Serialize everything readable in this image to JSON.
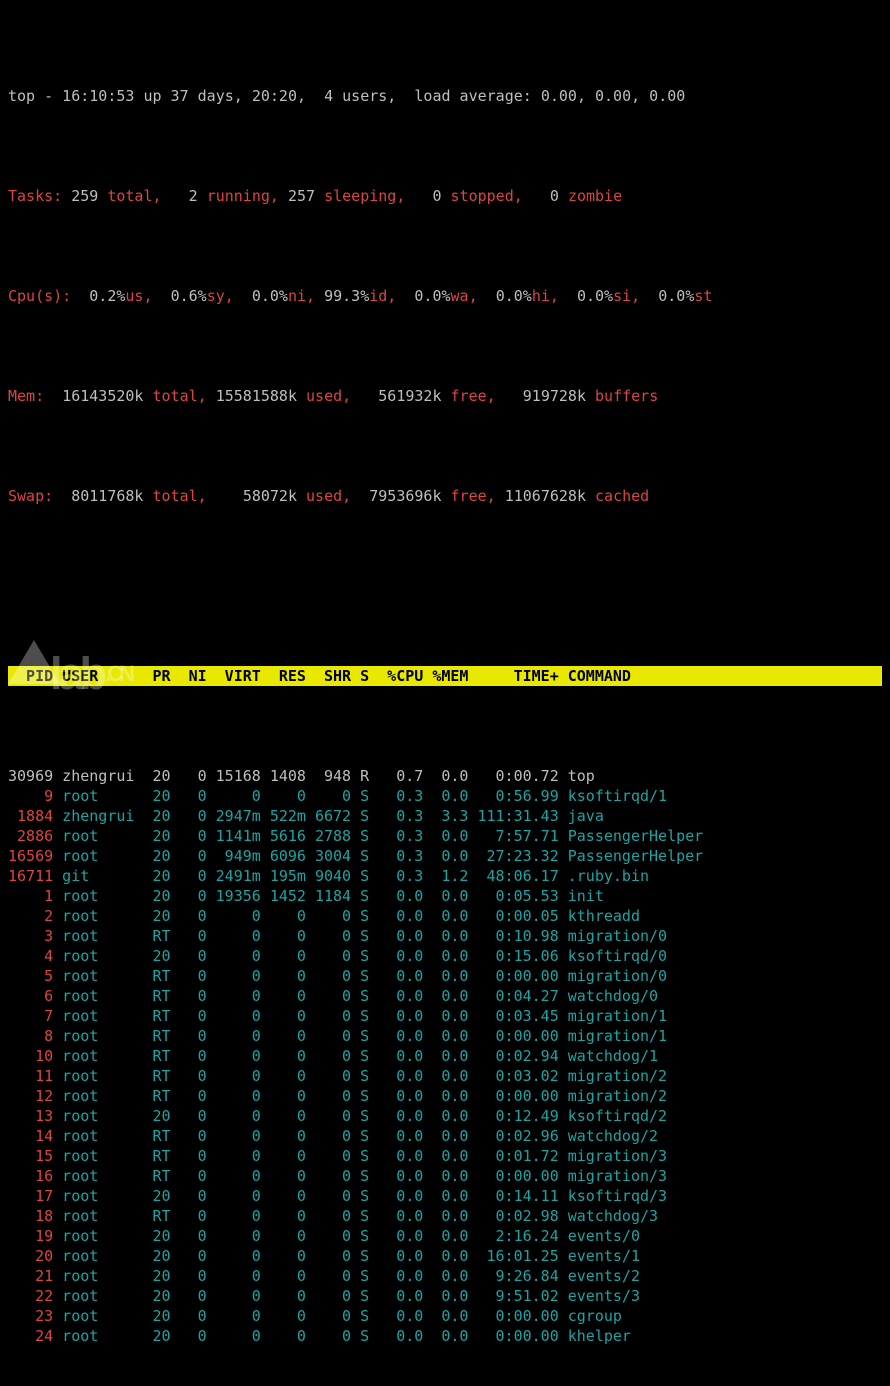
{
  "summary": {
    "line1_a": "top - 16:10:53 up 37 days, 20:20,  4 users,  load average: 0.00, 0.00, 0.00",
    "tasks": {
      "label": "Tasks:",
      "total": "259",
      "total_lbl": "total,",
      "running": "2",
      "running_lbl": "running,",
      "sleeping": "257",
      "sleeping_lbl": "sleeping,",
      "stopped": "0",
      "stopped_lbl": "stopped,",
      "zombie": "0",
      "zombie_lbl": "zombie"
    },
    "cpu": {
      "label": "Cpu(s):",
      "us": "0.2%",
      "us_lbl": "us,",
      "sy": "0.6%",
      "sy_lbl": "sy,",
      "ni": "0.0%",
      "ni_lbl": "ni,",
      "id": "99.3%",
      "id_lbl": "id,",
      "wa": "0.0%",
      "wa_lbl": "wa,",
      "hi": "0.0%",
      "hi_lbl": "hi,",
      "si": "0.0%",
      "si_lbl": "si,",
      "st": "0.0%",
      "st_lbl": "st"
    },
    "mem": {
      "label": "Mem:",
      "total": "16143520k",
      "total_lbl": "total,",
      "used": "15581588k",
      "used_lbl": "used,",
      "free": "561932k",
      "free_lbl": "free,",
      "buffers": "919728k",
      "buffers_lbl": "buffers"
    },
    "swap": {
      "label": "Swap:",
      "total": "8011768k",
      "total_lbl": "total,",
      "used": "58072k",
      "used_lbl": "used,",
      "free": "7953696k",
      "free_lbl": "free,",
      "cached": "11067628k",
      "cached_lbl": "cached"
    }
  },
  "columns": {
    "pid": "PID",
    "user": "USER",
    "pr": "PR",
    "ni": "NI",
    "virt": "VIRT",
    "res": "RES",
    "shr": "SHR",
    "s": "S",
    "cpu": "%CPU",
    "mem": "%MEM",
    "time": "TIME+",
    "cmd": "COMMAND"
  },
  "rows": [
    {
      "pid": "30969",
      "user": "zhengrui",
      "pr": "20",
      "ni": "0",
      "virt": "15168",
      "res": "1408",
      "shr": "948",
      "s": "R",
      "cpu": "0.7",
      "mem": "0.0",
      "time": "0:00.72",
      "cmd": "top",
      "hl": false
    },
    {
      "pid": "9",
      "user": "root",
      "pr": "20",
      "ni": "0",
      "virt": "0",
      "res": "0",
      "shr": "0",
      "s": "S",
      "cpu": "0.3",
      "mem": "0.0",
      "time": "0:56.99",
      "cmd": "ksoftirqd/1",
      "hl": true
    },
    {
      "pid": "1884",
      "user": "zhengrui",
      "pr": "20",
      "ni": "0",
      "virt": "2947m",
      "res": "522m",
      "shr": "6672",
      "s": "S",
      "cpu": "0.3",
      "mem": "3.3",
      "time": "111:31.43",
      "cmd": "java",
      "hl": true
    },
    {
      "pid": "2886",
      "user": "root",
      "pr": "20",
      "ni": "0",
      "virt": "1141m",
      "res": "5616",
      "shr": "2788",
      "s": "S",
      "cpu": "0.3",
      "mem": "0.0",
      "time": "7:57.71",
      "cmd": "PassengerHelper",
      "hl": true
    },
    {
      "pid": "16569",
      "user": "root",
      "pr": "20",
      "ni": "0",
      "virt": "949m",
      "res": "6096",
      "shr": "3004",
      "s": "S",
      "cpu": "0.3",
      "mem": "0.0",
      "time": "27:23.32",
      "cmd": "PassengerHelper",
      "hl": true
    },
    {
      "pid": "16711",
      "user": "git",
      "pr": "20",
      "ni": "0",
      "virt": "2491m",
      "res": "195m",
      "shr": "9040",
      "s": "S",
      "cpu": "0.3",
      "mem": "1.2",
      "time": "48:06.17",
      "cmd": ".ruby.bin",
      "hl": true
    },
    {
      "pid": "1",
      "user": "root",
      "pr": "20",
      "ni": "0",
      "virt": "19356",
      "res": "1452",
      "shr": "1184",
      "s": "S",
      "cpu": "0.0",
      "mem": "0.0",
      "time": "0:05.53",
      "cmd": "init",
      "hl": true
    },
    {
      "pid": "2",
      "user": "root",
      "pr": "20",
      "ni": "0",
      "virt": "0",
      "res": "0",
      "shr": "0",
      "s": "S",
      "cpu": "0.0",
      "mem": "0.0",
      "time": "0:00.05",
      "cmd": "kthreadd",
      "hl": true
    },
    {
      "pid": "3",
      "user": "root",
      "pr": "RT",
      "ni": "0",
      "virt": "0",
      "res": "0",
      "shr": "0",
      "s": "S",
      "cpu": "0.0",
      "mem": "0.0",
      "time": "0:10.98",
      "cmd": "migration/0",
      "hl": true
    },
    {
      "pid": "4",
      "user": "root",
      "pr": "20",
      "ni": "0",
      "virt": "0",
      "res": "0",
      "shr": "0",
      "s": "S",
      "cpu": "0.0",
      "mem": "0.0",
      "time": "0:15.06",
      "cmd": "ksoftirqd/0",
      "hl": true
    },
    {
      "pid": "5",
      "user": "root",
      "pr": "RT",
      "ni": "0",
      "virt": "0",
      "res": "0",
      "shr": "0",
      "s": "S",
      "cpu": "0.0",
      "mem": "0.0",
      "time": "0:00.00",
      "cmd": "migration/0",
      "hl": true
    },
    {
      "pid": "6",
      "user": "root",
      "pr": "RT",
      "ni": "0",
      "virt": "0",
      "res": "0",
      "shr": "0",
      "s": "S",
      "cpu": "0.0",
      "mem": "0.0",
      "time": "0:04.27",
      "cmd": "watchdog/0",
      "hl": true
    },
    {
      "pid": "7",
      "user": "root",
      "pr": "RT",
      "ni": "0",
      "virt": "0",
      "res": "0",
      "shr": "0",
      "s": "S",
      "cpu": "0.0",
      "mem": "0.0",
      "time": "0:03.45",
      "cmd": "migration/1",
      "hl": true
    },
    {
      "pid": "8",
      "user": "root",
      "pr": "RT",
      "ni": "0",
      "virt": "0",
      "res": "0",
      "shr": "0",
      "s": "S",
      "cpu": "0.0",
      "mem": "0.0",
      "time": "0:00.00",
      "cmd": "migration/1",
      "hl": true
    },
    {
      "pid": "10",
      "user": "root",
      "pr": "RT",
      "ni": "0",
      "virt": "0",
      "res": "0",
      "shr": "0",
      "s": "S",
      "cpu": "0.0",
      "mem": "0.0",
      "time": "0:02.94",
      "cmd": "watchdog/1",
      "hl": true
    },
    {
      "pid": "11",
      "user": "root",
      "pr": "RT",
      "ni": "0",
      "virt": "0",
      "res": "0",
      "shr": "0",
      "s": "S",
      "cpu": "0.0",
      "mem": "0.0",
      "time": "0:03.02",
      "cmd": "migration/2",
      "hl": true
    },
    {
      "pid": "12",
      "user": "root",
      "pr": "RT",
      "ni": "0",
      "virt": "0",
      "res": "0",
      "shr": "0",
      "s": "S",
      "cpu": "0.0",
      "mem": "0.0",
      "time": "0:00.00",
      "cmd": "migration/2",
      "hl": true
    },
    {
      "pid": "13",
      "user": "root",
      "pr": "20",
      "ni": "0",
      "virt": "0",
      "res": "0",
      "shr": "0",
      "s": "S",
      "cpu": "0.0",
      "mem": "0.0",
      "time": "0:12.49",
      "cmd": "ksoftirqd/2",
      "hl": true
    },
    {
      "pid": "14",
      "user": "root",
      "pr": "RT",
      "ni": "0",
      "virt": "0",
      "res": "0",
      "shr": "0",
      "s": "S",
      "cpu": "0.0",
      "mem": "0.0",
      "time": "0:02.96",
      "cmd": "watchdog/2",
      "hl": true
    },
    {
      "pid": "15",
      "user": "root",
      "pr": "RT",
      "ni": "0",
      "virt": "0",
      "res": "0",
      "shr": "0",
      "s": "S",
      "cpu": "0.0",
      "mem": "0.0",
      "time": "0:01.72",
      "cmd": "migration/3",
      "hl": true
    },
    {
      "pid": "16",
      "user": "root",
      "pr": "RT",
      "ni": "0",
      "virt": "0",
      "res": "0",
      "shr": "0",
      "s": "S",
      "cpu": "0.0",
      "mem": "0.0",
      "time": "0:00.00",
      "cmd": "migration/3",
      "hl": true
    },
    {
      "pid": "17",
      "user": "root",
      "pr": "20",
      "ni": "0",
      "virt": "0",
      "res": "0",
      "shr": "0",
      "s": "S",
      "cpu": "0.0",
      "mem": "0.0",
      "time": "0:14.11",
      "cmd": "ksoftirqd/3",
      "hl": true
    },
    {
      "pid": "18",
      "user": "root",
      "pr": "RT",
      "ni": "0",
      "virt": "0",
      "res": "0",
      "shr": "0",
      "s": "S",
      "cpu": "0.0",
      "mem": "0.0",
      "time": "0:02.98",
      "cmd": "watchdog/3",
      "hl": true
    },
    {
      "pid": "19",
      "user": "root",
      "pr": "20",
      "ni": "0",
      "virt": "0",
      "res": "0",
      "shr": "0",
      "s": "S",
      "cpu": "0.0",
      "mem": "0.0",
      "time": "2:16.24",
      "cmd": "events/0",
      "hl": true
    },
    {
      "pid": "20",
      "user": "root",
      "pr": "20",
      "ni": "0",
      "virt": "0",
      "res": "0",
      "shr": "0",
      "s": "S",
      "cpu": "0.0",
      "mem": "0.0",
      "time": "16:01.25",
      "cmd": "events/1",
      "hl": true
    },
    {
      "pid": "21",
      "user": "root",
      "pr": "20",
      "ni": "0",
      "virt": "0",
      "res": "0",
      "shr": "0",
      "s": "S",
      "cpu": "0.0",
      "mem": "0.0",
      "time": "9:26.84",
      "cmd": "events/2",
      "hl": true
    },
    {
      "pid": "22",
      "user": "root",
      "pr": "20",
      "ni": "0",
      "virt": "0",
      "res": "0",
      "shr": "0",
      "s": "S",
      "cpu": "0.0",
      "mem": "0.0",
      "time": "9:51.02",
      "cmd": "events/3",
      "hl": true
    },
    {
      "pid": "23",
      "user": "root",
      "pr": "20",
      "ni": "0",
      "virt": "0",
      "res": "0",
      "shr": "0",
      "s": "S",
      "cpu": "0.0",
      "mem": "0.0",
      "time": "0:00.00",
      "cmd": "cgroup",
      "hl": true
    },
    {
      "pid": "24",
      "user": "root",
      "pr": "20",
      "ni": "0",
      "virt": "0",
      "res": "0",
      "shr": "0",
      "s": "S",
      "cpu": "0.0",
      "mem": "0.0",
      "time": "0:00.00",
      "cmd": "khelper",
      "hl": true
    }
  ],
  "watermark": {
    "text": "lab",
    "suffix": ".CN"
  }
}
